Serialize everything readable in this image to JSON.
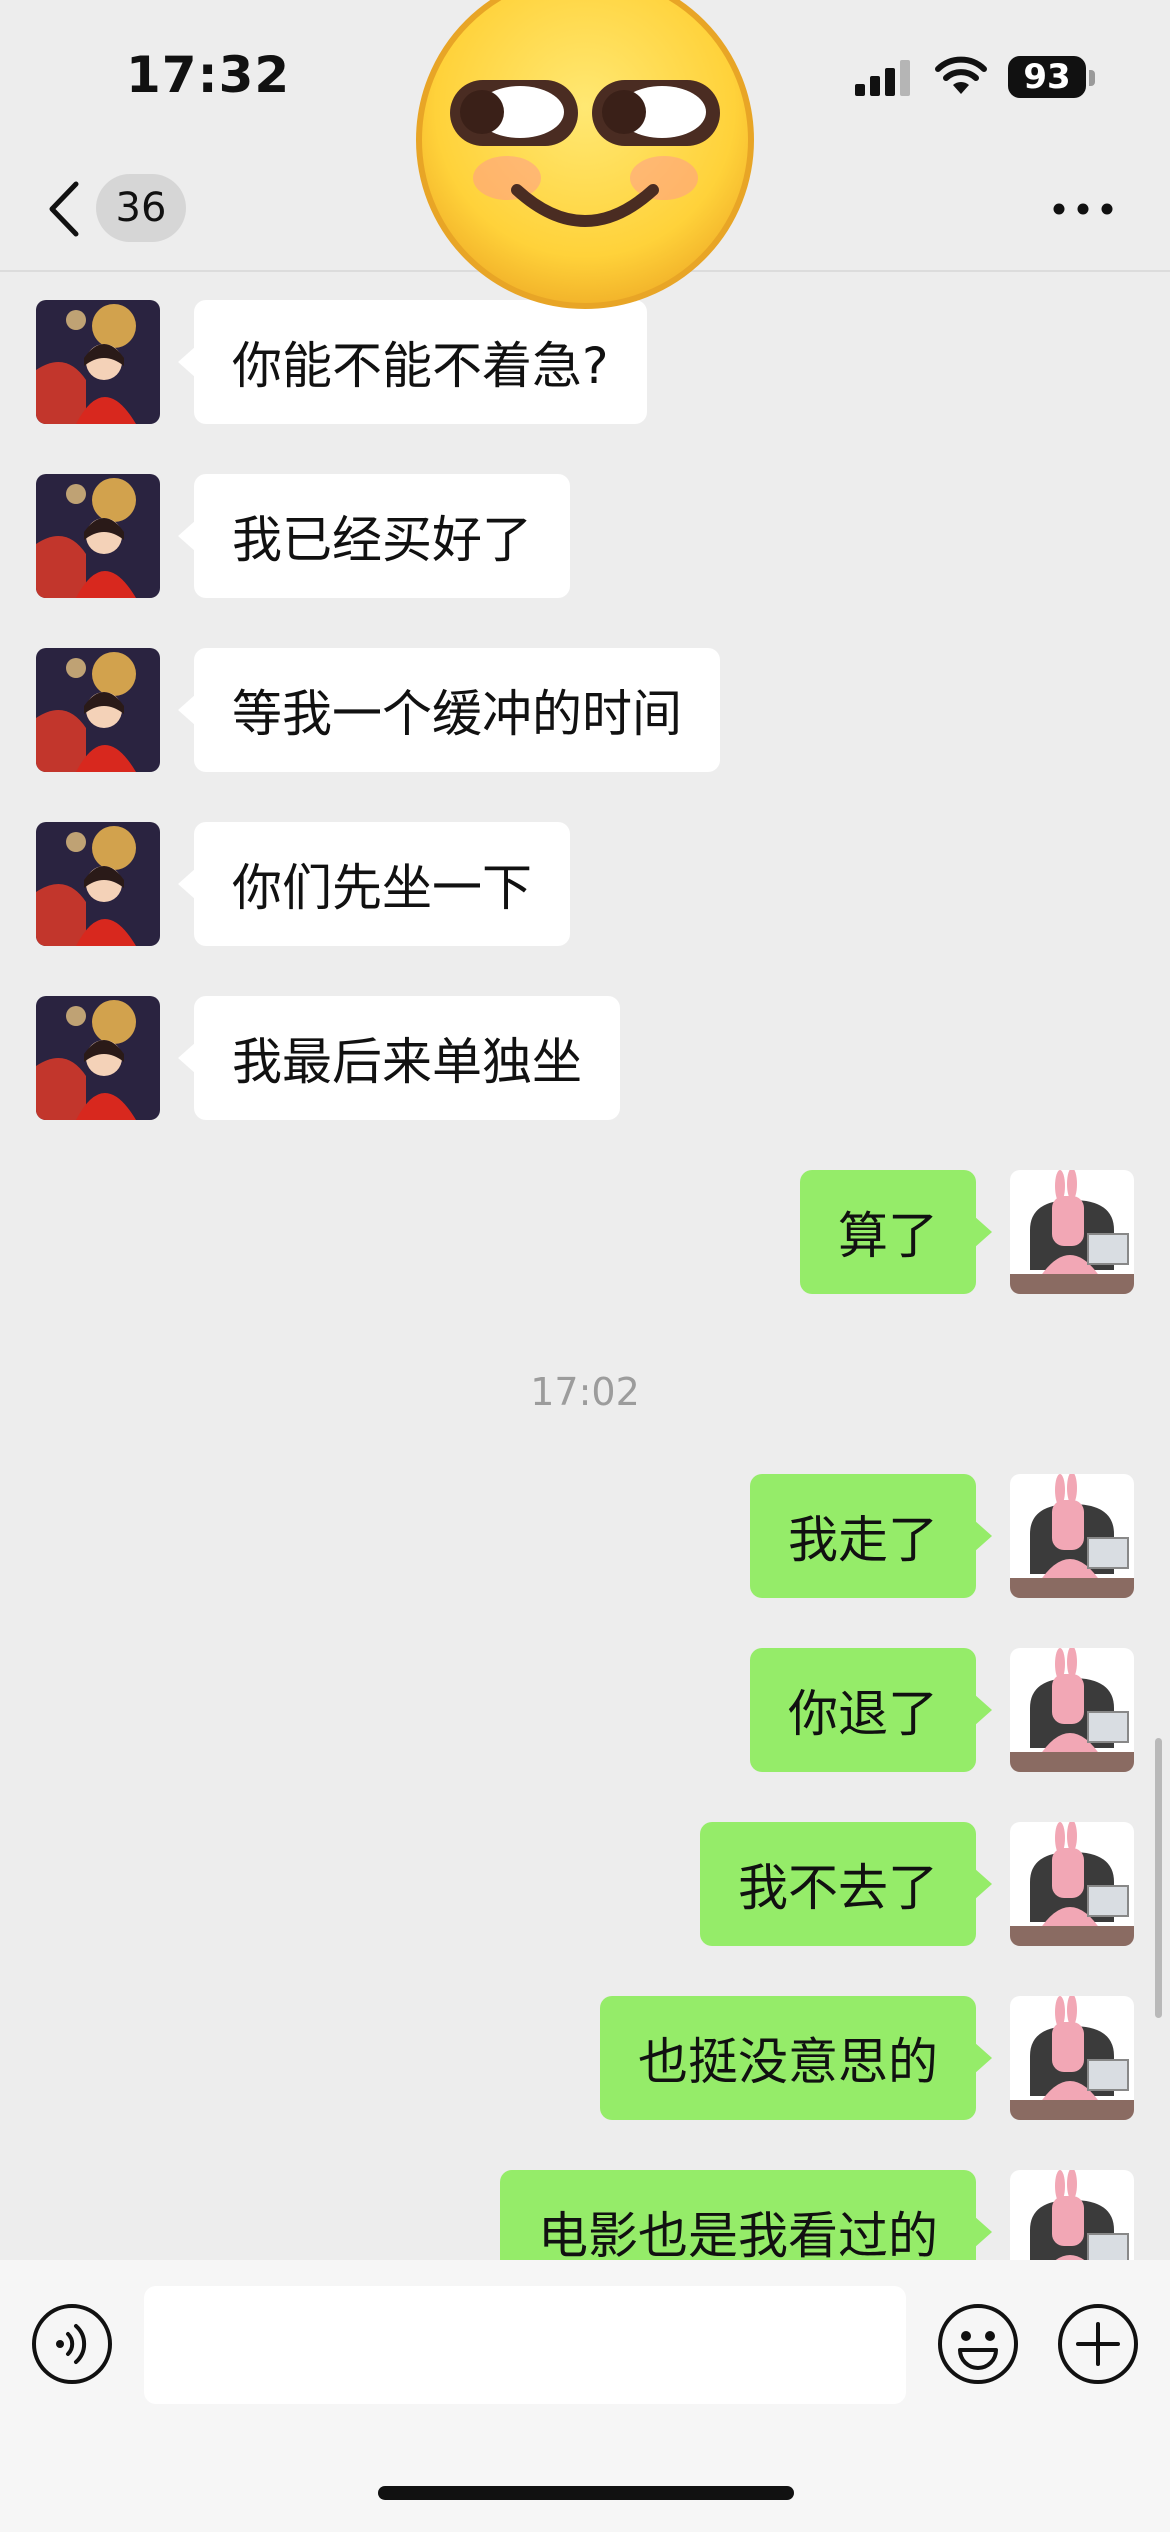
{
  "status_bar": {
    "time": "17:32",
    "battery": "93"
  },
  "nav": {
    "back_icon": "chevron-left-icon",
    "unread_count": "36",
    "more_icon": "ellipsis-icon",
    "sticker": "smug-smile-emoji"
  },
  "messages": [
    {
      "side": "left",
      "text": "你能不能不着急?"
    },
    {
      "side": "left",
      "text": "我已经买好了"
    },
    {
      "side": "left",
      "text": "等我一个缓冲的时间"
    },
    {
      "side": "left",
      "text": "你们先坐一下"
    },
    {
      "side": "left",
      "text": "我最后来单独坐"
    },
    {
      "side": "right",
      "text": "算了"
    },
    {
      "side": "right",
      "text": "我走了"
    },
    {
      "side": "right",
      "text": "你退了"
    },
    {
      "side": "right",
      "text": "我不去了"
    },
    {
      "side": "right",
      "text": "也挺没意思的"
    },
    {
      "side": "right",
      "text": "电影也是我看过的"
    }
  ],
  "timestamp": "17:02",
  "input_bar": {
    "voice_icon": "voice-icon",
    "input_value": "",
    "emoji_icon": "emoji-icon",
    "plus_icon": "plus-icon"
  },
  "colors": {
    "background": "#ededed",
    "incoming_bubble": "#ffffff",
    "outgoing_bubble": "#95ec69"
  }
}
